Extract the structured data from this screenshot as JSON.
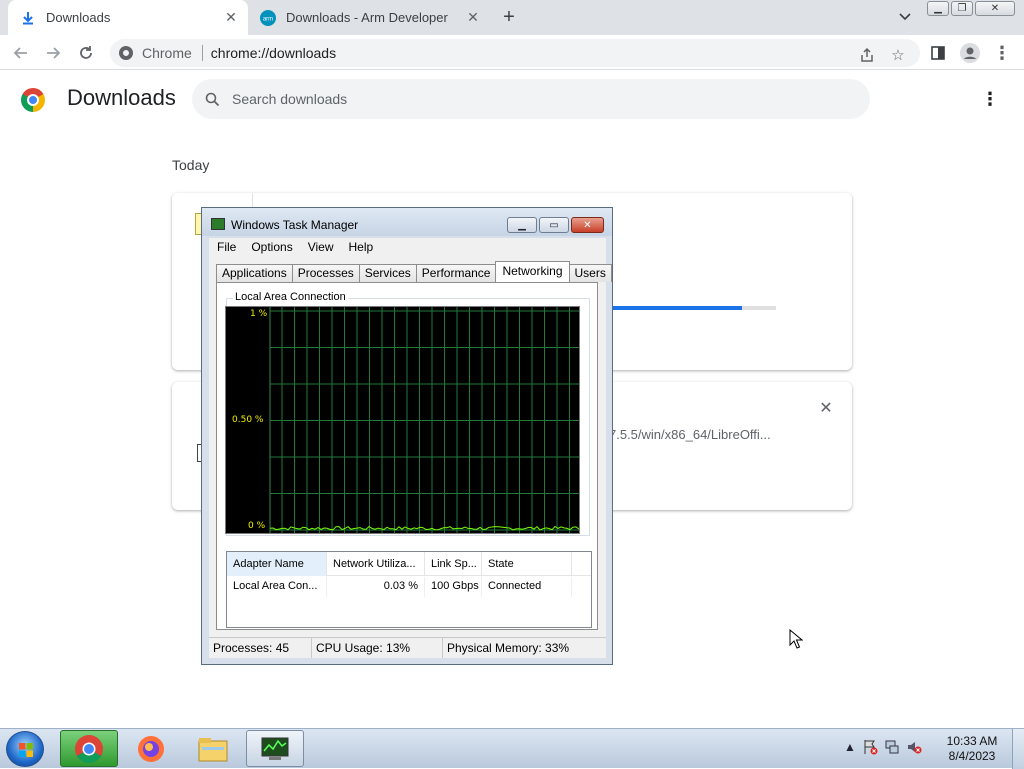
{
  "browser": {
    "tabs": [
      {
        "title": "Downloads",
        "icon": "download-icon",
        "active": true
      },
      {
        "title": "Downloads - Arm Developer",
        "icon": "arm-icon",
        "active": false
      }
    ],
    "omnibox": {
      "chip": "Chrome",
      "url": "chrome://downloads"
    }
  },
  "downloads_page": {
    "title": "Downloads",
    "search_placeholder": "Search downloads",
    "section_label": "Today",
    "items": [
      {
        "progress": 0.79
      },
      {
        "url_fragment": "7.5.5/win/x86_64/LibreOffi..."
      }
    ]
  },
  "task_manager": {
    "title": "Windows Task Manager",
    "menu": [
      "File",
      "Options",
      "View",
      "Help"
    ],
    "tabs": [
      "Applications",
      "Processes",
      "Services",
      "Performance",
      "Networking",
      "Users"
    ],
    "active_tab": "Networking",
    "group_label": "Local Area Connection",
    "graph": {
      "y_labels": [
        "1 %",
        "0.50 %",
        "0 %"
      ]
    },
    "table": {
      "columns": [
        "Adapter Name",
        "Network Utiliza...",
        "Link Sp...",
        "State"
      ],
      "rows": [
        [
          "Local Area Con...",
          "0.03 %",
          "100 Gbps",
          "Connected"
        ]
      ]
    },
    "status": {
      "processes": "Processes: 45",
      "cpu": "CPU Usage: 13%",
      "memory": "Physical Memory: 33%"
    }
  },
  "taskbar": {
    "apps": [
      "chrome-icon",
      "firefox-icon",
      "file-explorer-icon",
      "task-manager-icon"
    ],
    "clock_time": "10:33 AM",
    "clock_date": "8/4/2023"
  }
}
